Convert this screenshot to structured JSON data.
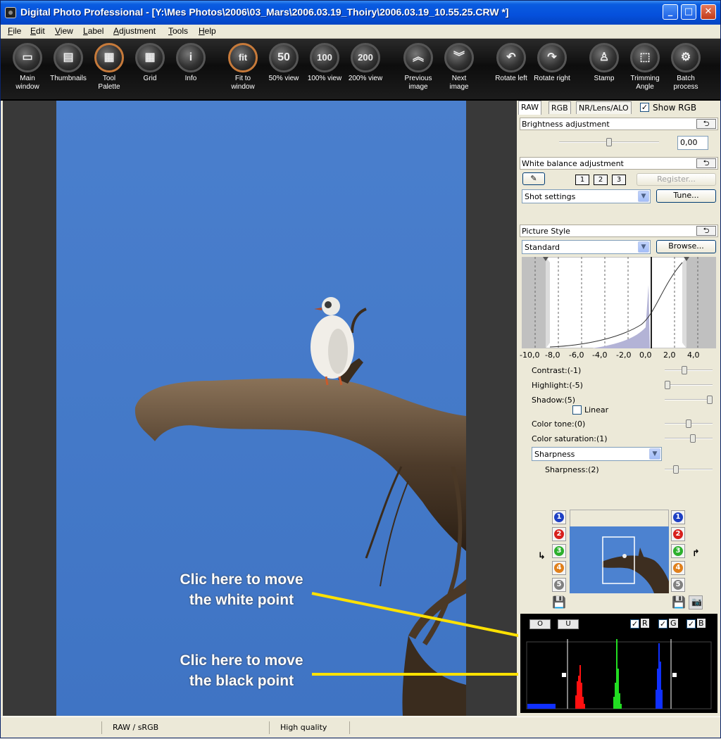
{
  "window": {
    "title": "Digital Photo Professional - [Y:\\Mes Photos\\2006\\03_Mars\\2006.03.19_Thoiry\\2006.03.19_10.55.25.CRW *]",
    "minimize": "_",
    "maximize": "□",
    "close": "✕"
  },
  "menu": [
    "File",
    "Edit",
    "View",
    "Label",
    "Adjustment",
    "Tools",
    "Help"
  ],
  "toolbar": [
    {
      "label": "Main\nwindow",
      "icon": "main-window-icon",
      "glyph": "▭"
    },
    {
      "label": "Thumbnails",
      "icon": "thumbnails-icon",
      "glyph": "▤"
    },
    {
      "label": "Tool\nPalette",
      "icon": "tool-palette-icon",
      "glyph": "▦"
    },
    {
      "label": "Grid",
      "icon": "grid-icon",
      "glyph": "▦"
    },
    {
      "label": "Info",
      "icon": "info-icon",
      "glyph": "i"
    },
    {
      "label": "Fit to\nwindow",
      "icon": "fit-icon",
      "glyph": "fit"
    },
    {
      "label": "50% view",
      "icon": "zoom-50-icon",
      "glyph": "50"
    },
    {
      "label": "100% view",
      "icon": "zoom-100-icon",
      "glyph": "100"
    },
    {
      "label": "200% view",
      "icon": "zoom-200-icon",
      "glyph": "200"
    },
    {
      "label": "Previous\nimage",
      "icon": "previous-image-icon",
      "glyph": "︽"
    },
    {
      "label": "Next\nimage",
      "icon": "next-image-icon",
      "glyph": "︾"
    },
    {
      "label": "Rotate left",
      "icon": "rotate-left-icon",
      "glyph": "↶"
    },
    {
      "label": "Rotate right",
      "icon": "rotate-right-icon",
      "glyph": "↷"
    },
    {
      "label": "Stamp",
      "icon": "stamp-icon",
      "glyph": "♙"
    },
    {
      "label": "Trimming\nAngle",
      "icon": "trimming-angle-icon",
      "glyph": "⬚"
    },
    {
      "label": "Batch\nprocess",
      "icon": "batch-process-icon",
      "glyph": "⚙"
    }
  ],
  "panel": {
    "tabs": [
      "RAW",
      "RGB",
      "NR/Lens/ALO"
    ],
    "show_rgb_label": "Show RGB",
    "show_rgb_checked": true,
    "brightness": {
      "title": "Brightness adjustment",
      "value": "0,00",
      "slider": 0.5
    },
    "white_balance": {
      "title": "White balance adjustment",
      "presets": [
        "1",
        "2",
        "3"
      ],
      "register": "Register...",
      "mode": "Shot settings",
      "tune": "Tune..."
    },
    "picture_style": {
      "title": "Picture Style",
      "style": "Standard",
      "browse": "Browse...",
      "axis_ticks": [
        "-10,0",
        "-8,0",
        "-6,0",
        "-4,0",
        "-2,0",
        "0,0",
        "2,0",
        "4,0"
      ],
      "sliders": [
        {
          "label": "Contrast:(-1)",
          "value": 0.4
        },
        {
          "label": "Highlight:(-5)",
          "value": 0.0
        },
        {
          "label": "Shadow:(5)",
          "value": 1.0
        },
        {
          "label": "Color tone:(0)",
          "value": 0.5
        },
        {
          "label": "Color saturation:(1)",
          "value": 0.6
        }
      ],
      "linear_label": "Linear",
      "sharpness_combo": "Sharpness",
      "sharpness_slider": {
        "label": "Sharpness:(2)",
        "value": 0.2
      }
    },
    "navigator": {
      "left_badges": [
        "1",
        "2",
        "3",
        "4",
        "5"
      ],
      "right_badges": [
        "1",
        "2",
        "3",
        "4",
        "5"
      ]
    },
    "histogram": {
      "buttons": [
        "O",
        "U"
      ],
      "channels": [
        {
          "name": "R",
          "checked": true
        },
        {
          "name": "G",
          "checked": true
        },
        {
          "name": "B",
          "checked": true
        }
      ]
    }
  },
  "annotations": {
    "white_point": "Clic here to move\nthe white point",
    "black_point": "Clic here to move\nthe black point"
  },
  "status": {
    "cell1": "RAW / sRGB",
    "cell2": "High quality"
  },
  "colors": {
    "accent": "#ffe100",
    "sky": "#4a7fcd",
    "titlebar": "#0550dc"
  }
}
